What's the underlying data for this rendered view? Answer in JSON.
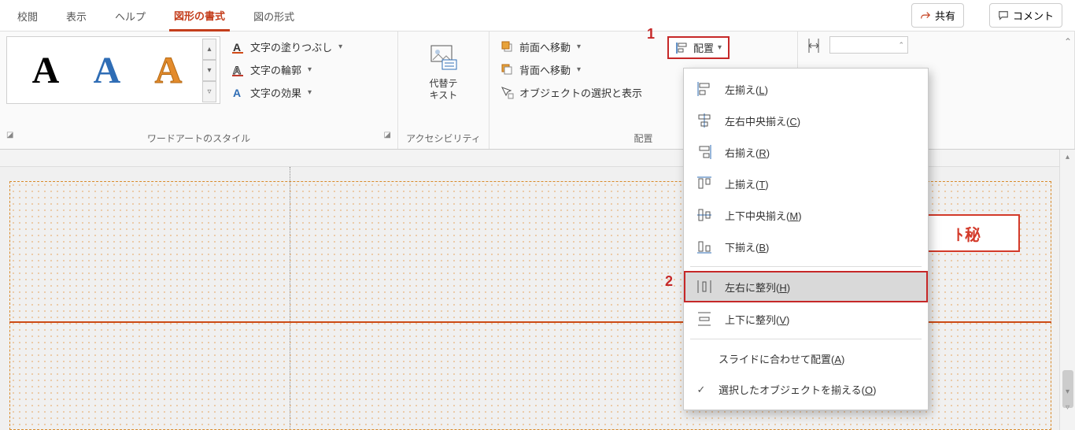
{
  "tabs": {
    "review": "校閲",
    "view": "表示",
    "help": "ヘルプ",
    "shape_format": "図形の書式",
    "picture_format": "図の形式"
  },
  "top_buttons": {
    "share": "共有",
    "comment": "コメント"
  },
  "ribbon": {
    "wordart": {
      "sample1": "A",
      "sample2": "A",
      "sample3": "A",
      "fill": "文字の塗りつぶし",
      "outline": "文字の輪郭",
      "effects": "文字の効果",
      "group_label": "ワードアートのスタイル"
    },
    "accessibility": {
      "alt_text_line1": "代替テ",
      "alt_text_line2": "キスト",
      "group_label": "アクセシビリティ"
    },
    "arrange": {
      "bring_forward": "前面へ移動",
      "send_backward": "背面へ移動",
      "selection_pane": "オブジェクトの選択と表示",
      "align": "配置",
      "group_label": "配置"
    },
    "size": {
      "group_label": ""
    }
  },
  "callouts": {
    "one": "1",
    "two": "2"
  },
  "align_menu": {
    "left": {
      "label": "左揃え(",
      "accel": "L",
      "suffix": ")"
    },
    "center_h": {
      "label": "左右中央揃え(",
      "accel": "C",
      "suffix": ")"
    },
    "right": {
      "label": "右揃え(",
      "accel": "R",
      "suffix": ")"
    },
    "top": {
      "label": "上揃え(",
      "accel": "T",
      "suffix": ")"
    },
    "middle": {
      "label": "上下中央揃え(",
      "accel": "M",
      "suffix": ")"
    },
    "bottom": {
      "label": "下揃え(",
      "accel": "B",
      "suffix": ")"
    },
    "dist_h": {
      "label": "左右に整列(",
      "accel": "H",
      "suffix": ")"
    },
    "dist_v": {
      "label": "上下に整列(",
      "accel": "V",
      "suffix": ")"
    },
    "to_slide": {
      "label": "スライドに合わせて配置(",
      "accel": "A",
      "suffix": ")"
    },
    "to_sel": {
      "label": "選択したオブジェクトを揃える(",
      "accel": "O",
      "suffix": ")"
    }
  },
  "slide": {
    "badge_visible_text": "ﾄ秘"
  }
}
